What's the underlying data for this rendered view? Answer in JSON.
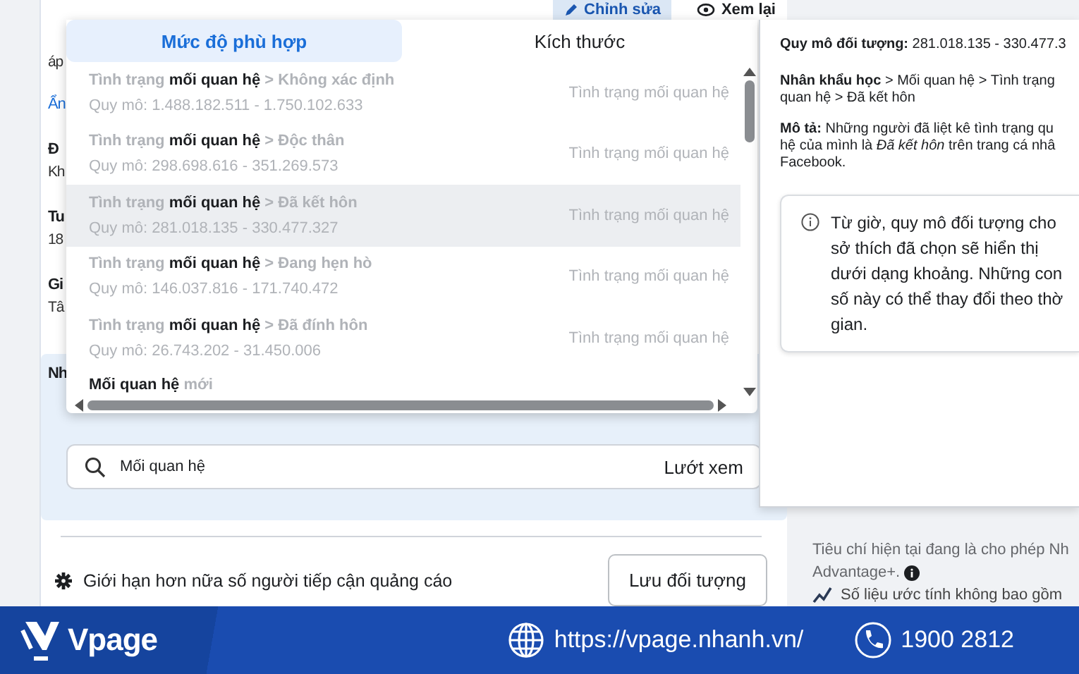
{
  "header": {
    "edit_button": "Chỉnh sửa",
    "review_button": "Xem lại"
  },
  "left_fragments": [
    {
      "text": "áp",
      "kind": "plain"
    },
    {
      "text": "Ẩn",
      "kind": "link"
    },
    {
      "text": "Đ",
      "kind": "heading"
    },
    {
      "text": "Kh",
      "kind": "plain"
    },
    {
      "text": "Tu",
      "kind": "heading"
    },
    {
      "text": "18",
      "kind": "plain"
    },
    {
      "text": "Gi",
      "kind": "heading"
    },
    {
      "text": "Tâ",
      "kind": "plain"
    }
  ],
  "detailed_card": {
    "heading": "Nh",
    "search": {
      "value": "Mối quan hệ",
      "browse": "Lướt xem"
    }
  },
  "limit_row": {
    "label": "Giới hạn hơn nữa số người tiếp cận quảng cáo",
    "save_button": "Lưu đối tượng"
  },
  "right_column": {
    "note": "Tiêu chí hiện tại đang là cho phép Nh",
    "advantage": "Advantage+.",
    "estimate": "Số liệu ước tính không bao gồm"
  },
  "dropdown": {
    "tabs": [
      {
        "label": "Mức độ phù hợp",
        "selected": true
      },
      {
        "label": "Kích thước",
        "selected": false
      }
    ],
    "rows": [
      {
        "title": "Tình trạng **mối quan hệ** > Không xác định",
        "size": "Quy mô: 1.488.182.511 - 1.750.102.633",
        "category": "Tình trạng mối quan hệ",
        "selected": false
      },
      {
        "title": "Tình trạng **mối quan hệ** > Độc thân",
        "size": "Quy mô: 298.698.616 - 351.269.573",
        "category": "Tình trạng mối quan hệ",
        "selected": false
      },
      {
        "title": "Tình trạng **mối quan hệ** > Đã kết hôn",
        "size": "Quy mô: 281.018.135 - 330.477.327",
        "category": "Tình trạng mối quan hệ",
        "selected": true
      },
      {
        "title": "Tình trạng **mối quan hệ** > Đang hẹn hò",
        "size": "Quy mô: 146.037.816 - 171.740.472",
        "category": "Tình trạng mối quan hệ",
        "selected": false
      },
      {
        "title": "Tình trạng **mối quan hệ** > Đã đính hôn",
        "size": "Quy mô: 26.743.202 - 31.450.006",
        "category": "Tình trạng mối quan hệ",
        "selected": false
      },
      {
        "title": "**Mối quan hệ** mới",
        "selected": false
      }
    ]
  },
  "detail_panel": {
    "size": "**Quy mô đối tượng:** 281.018.135 - 330.477.3",
    "path_lines": [
      "**Nhân khẩu học** > Mối quan hệ > Tình trạng",
      "quan hệ > Đã kết hôn"
    ],
    "description_lines": [
      "**Mô tả:** Những người đã liệt kê tình trạng qu",
      "hệ của mình là *Đã kết hôn* trên trang cá nhâ",
      "Facebook."
    ],
    "info_lines": [
      "Từ giờ, quy mô đối tượng cho",
      "sở thích đã chọn sẽ hiển thị",
      "dưới dạng khoảng. Những con",
      "số này có thể thay đổi theo thờ",
      "gian."
    ]
  },
  "footer": {
    "brand": "Vpage",
    "url": "https://vpage.nhanh.vn/",
    "phone": "1900 2812"
  }
}
